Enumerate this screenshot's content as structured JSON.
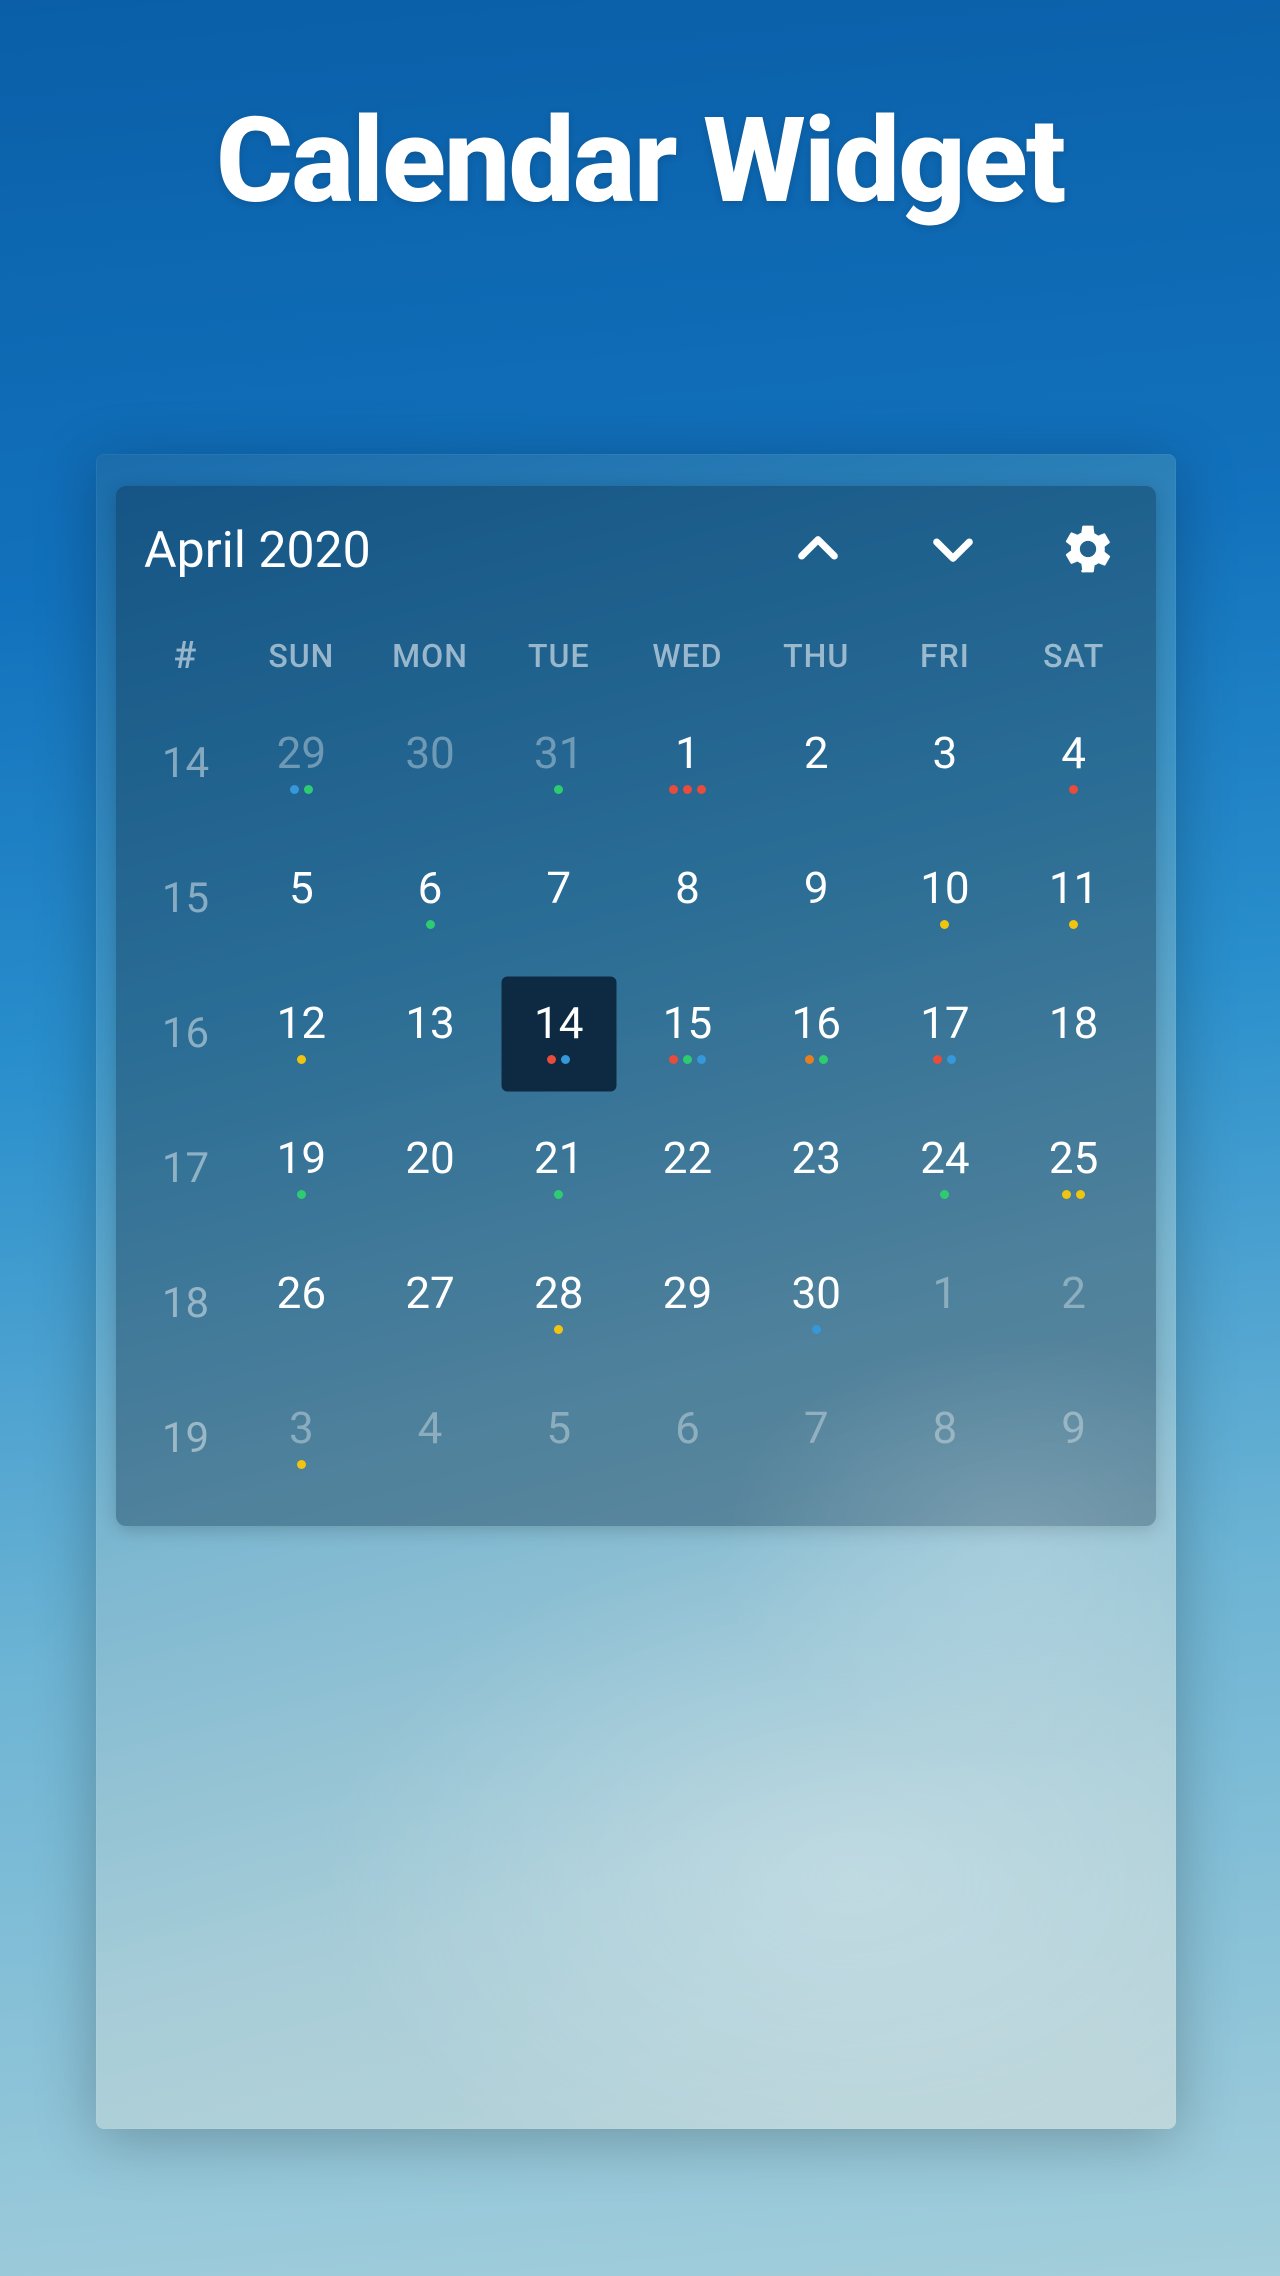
{
  "page": {
    "title": "Calendar Widget"
  },
  "widget": {
    "month_label": "April 2020",
    "week_header": "#",
    "day_headers": [
      "SUN",
      "MON",
      "TUE",
      "WED",
      "THU",
      "FRI",
      "SAT"
    ],
    "icons": {
      "prev": "chevron-up",
      "next": "chevron-down",
      "settings": "gear"
    },
    "rows": [
      {
        "week": "14",
        "days": [
          {
            "n": "29",
            "other": true,
            "today": false,
            "dots": [
              "blue",
              "green"
            ]
          },
          {
            "n": "30",
            "other": true,
            "today": false,
            "dots": []
          },
          {
            "n": "31",
            "other": true,
            "today": false,
            "dots": [
              "green"
            ]
          },
          {
            "n": "1",
            "other": false,
            "today": false,
            "dots": [
              "red",
              "red",
              "red"
            ]
          },
          {
            "n": "2",
            "other": false,
            "today": false,
            "dots": []
          },
          {
            "n": "3",
            "other": false,
            "today": false,
            "dots": []
          },
          {
            "n": "4",
            "other": false,
            "today": false,
            "dots": [
              "red"
            ]
          }
        ]
      },
      {
        "week": "15",
        "days": [
          {
            "n": "5",
            "other": false,
            "today": false,
            "dots": []
          },
          {
            "n": "6",
            "other": false,
            "today": false,
            "dots": [
              "green"
            ]
          },
          {
            "n": "7",
            "other": false,
            "today": false,
            "dots": []
          },
          {
            "n": "8",
            "other": false,
            "today": false,
            "dots": []
          },
          {
            "n": "9",
            "other": false,
            "today": false,
            "dots": []
          },
          {
            "n": "10",
            "other": false,
            "today": false,
            "dots": [
              "yellow"
            ]
          },
          {
            "n": "11",
            "other": false,
            "today": false,
            "dots": [
              "yellow"
            ]
          }
        ]
      },
      {
        "week": "16",
        "days": [
          {
            "n": "12",
            "other": false,
            "today": false,
            "dots": [
              "yellow"
            ]
          },
          {
            "n": "13",
            "other": false,
            "today": false,
            "dots": []
          },
          {
            "n": "14",
            "other": false,
            "today": true,
            "dots": [
              "red",
              "blue"
            ]
          },
          {
            "n": "15",
            "other": false,
            "today": false,
            "dots": [
              "red",
              "green",
              "blue"
            ]
          },
          {
            "n": "16",
            "other": false,
            "today": false,
            "dots": [
              "orange",
              "green"
            ]
          },
          {
            "n": "17",
            "other": false,
            "today": false,
            "dots": [
              "red",
              "blue"
            ]
          },
          {
            "n": "18",
            "other": false,
            "today": false,
            "dots": []
          }
        ]
      },
      {
        "week": "17",
        "days": [
          {
            "n": "19",
            "other": false,
            "today": false,
            "dots": [
              "green"
            ]
          },
          {
            "n": "20",
            "other": false,
            "today": false,
            "dots": []
          },
          {
            "n": "21",
            "other": false,
            "today": false,
            "dots": [
              "green"
            ]
          },
          {
            "n": "22",
            "other": false,
            "today": false,
            "dots": []
          },
          {
            "n": "23",
            "other": false,
            "today": false,
            "dots": []
          },
          {
            "n": "24",
            "other": false,
            "today": false,
            "dots": [
              "green"
            ]
          },
          {
            "n": "25",
            "other": false,
            "today": false,
            "dots": [
              "yellow",
              "yellow"
            ]
          }
        ]
      },
      {
        "week": "18",
        "days": [
          {
            "n": "26",
            "other": false,
            "today": false,
            "dots": []
          },
          {
            "n": "27",
            "other": false,
            "today": false,
            "dots": []
          },
          {
            "n": "28",
            "other": false,
            "today": false,
            "dots": [
              "yellow"
            ]
          },
          {
            "n": "29",
            "other": false,
            "today": false,
            "dots": []
          },
          {
            "n": "30",
            "other": false,
            "today": false,
            "dots": [
              "blue"
            ]
          },
          {
            "n": "1",
            "other": true,
            "today": false,
            "dots": []
          },
          {
            "n": "2",
            "other": true,
            "today": false,
            "dots": []
          }
        ]
      },
      {
        "week": "19",
        "days": [
          {
            "n": "3",
            "other": true,
            "today": false,
            "dots": [
              "yellow"
            ]
          },
          {
            "n": "4",
            "other": true,
            "today": false,
            "dots": []
          },
          {
            "n": "5",
            "other": true,
            "today": false,
            "dots": []
          },
          {
            "n": "6",
            "other": true,
            "today": false,
            "dots": []
          },
          {
            "n": "7",
            "other": true,
            "today": false,
            "dots": []
          },
          {
            "n": "8",
            "other": true,
            "today": false,
            "dots": []
          },
          {
            "n": "9",
            "other": true,
            "today": false,
            "dots": []
          }
        ]
      }
    ]
  }
}
